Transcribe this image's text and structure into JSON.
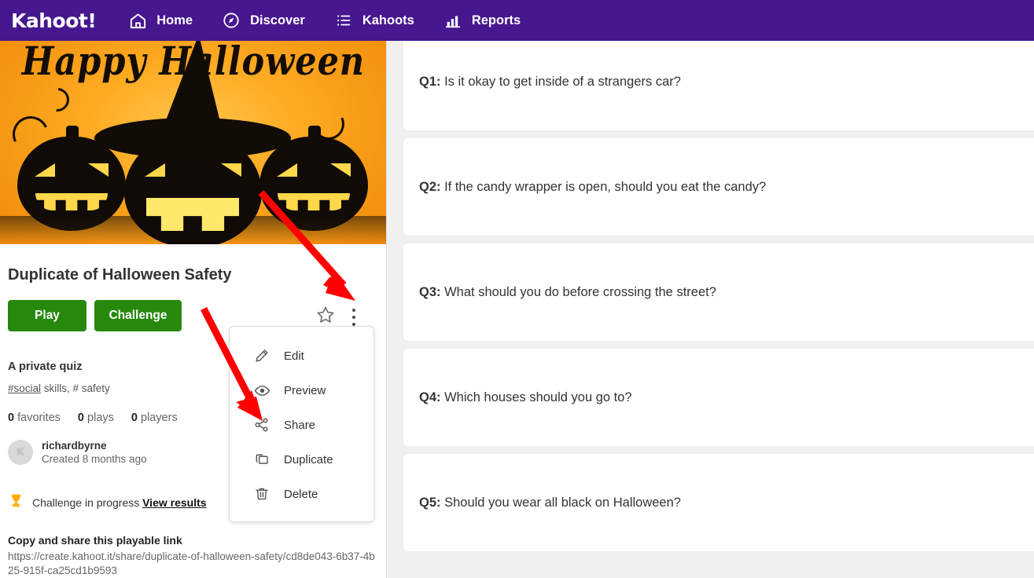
{
  "brand": {
    "logo_text": "Kahoot!",
    "purple": "#46178F",
    "green": "#26890C",
    "red_annotation": "#FF0000",
    "gold": "#FFAA00"
  },
  "nav": {
    "items": [
      {
        "label": "Home",
        "icon": "home-icon"
      },
      {
        "label": "Discover",
        "icon": "compass-icon"
      },
      {
        "label": "Kahoots",
        "icon": "list-icon"
      },
      {
        "label": "Reports",
        "icon": "bar-chart-icon"
      }
    ]
  },
  "cover": {
    "alt_text": "Happy Halloween",
    "headline": "Happy Halloween"
  },
  "details": {
    "title": "Duplicate of Halloween Safety",
    "play_label": "Play",
    "challenge_label": "Challenge",
    "privacy": "A private quiz",
    "tag_link": "#social",
    "tags_rest": " skills, # safety",
    "stats": {
      "favorites_count": "0",
      "favorites_label": "favorites",
      "plays_count": "0",
      "plays_label": "plays",
      "players_count": "0",
      "players_label": "players"
    },
    "author": "richardbyrne",
    "author_initial": "K",
    "created": "Created 8 months ago",
    "challenge_status": "Challenge in progress ",
    "view_results_label": "View results",
    "link_heading": "Copy and share this playable link",
    "link_url": "https://create.kahoot.it/share/duplicate-of-halloween-safety/cd8de043-6b37-4b25-915f-ca25cd1b9593"
  },
  "dropdown": {
    "items": [
      {
        "label": "Edit",
        "icon": "pencil-icon"
      },
      {
        "label": "Preview",
        "icon": "eye-icon"
      },
      {
        "label": "Share",
        "icon": "share-nodes-icon"
      },
      {
        "label": "Duplicate",
        "icon": "copy-icon"
      },
      {
        "label": "Delete",
        "icon": "trash-icon"
      }
    ]
  },
  "questions": [
    {
      "number": "Q1:",
      "text": " Is it okay to get inside of a strangers car?"
    },
    {
      "number": "Q2:",
      "text": " If the candy wrapper is open, should you eat the candy?"
    },
    {
      "number": "Q3:",
      "text": " What should you do before crossing the street?"
    },
    {
      "number": "Q4:",
      "text": " Which houses should you go to?"
    },
    {
      "number": "Q5:",
      "text": " Should you wear all black on Halloween?"
    }
  ]
}
